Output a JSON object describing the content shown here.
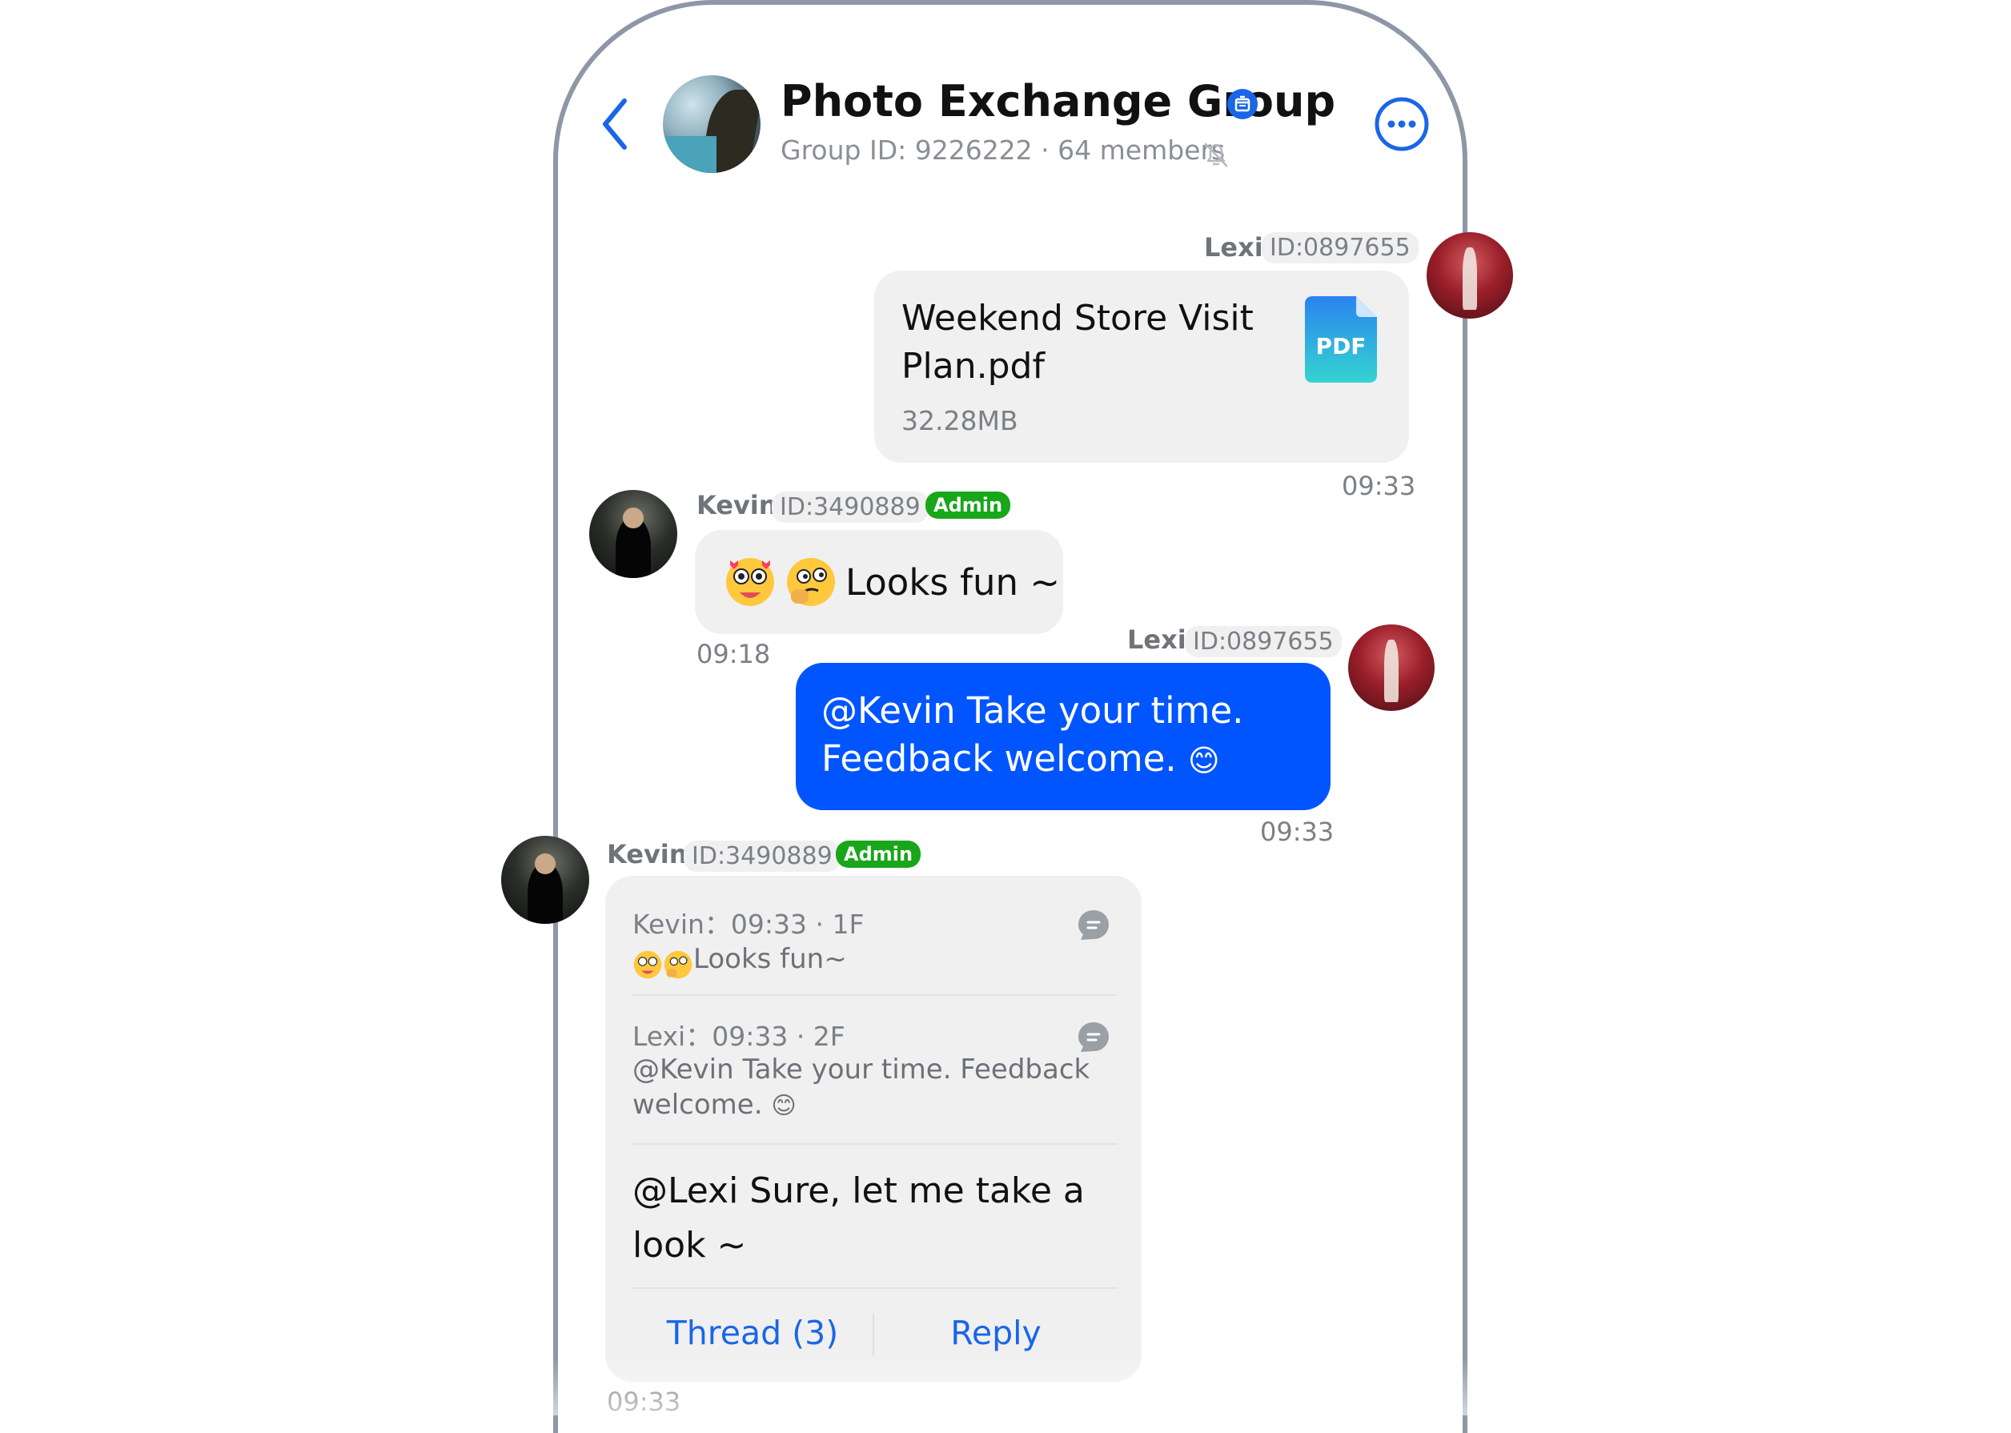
{
  "header": {
    "back_icon": "chevron-left-icon",
    "group_name": "Photo Exchange Group",
    "group_badge_icon": "verified-group-icon",
    "subtitle": "Group ID: 9226222 · 64 members",
    "muted_icon": "bell-off-icon",
    "more_icon": "more-horizontal-icon",
    "accent_color": "#0055ff"
  },
  "messages": {
    "m1": {
      "sender": "Lexi",
      "sender_id": "ID:0897655",
      "file_name_line1": "Weekend Store Visit",
      "file_name_line2": "Plan.pdf",
      "file_size": "32.28MB",
      "file_icon_label": "PDF",
      "time": "09:33"
    },
    "m2": {
      "sender": "Kevin",
      "sender_id": "ID:3490889",
      "role": "Admin",
      "text": "Looks fun ~",
      "time": "09:18"
    },
    "m3": {
      "sender": "Lexi",
      "sender_id": "ID:0897655",
      "line1": "@Kevin Take your time.",
      "line2": "Feedback welcome.",
      "emoji": "😊",
      "time": "09:33"
    },
    "m4": {
      "sender": "Kevin",
      "sender_id": "ID:3490889",
      "role": "Admin",
      "quote1_meta": "Kevin：09:33 · 1F",
      "quote1_text": "Looks fun~",
      "quote2_meta": "Lexi：09:33 · 2F",
      "quote2_line1": "@Kevin Take your time. Feedback",
      "quote2_line2": "welcome.",
      "quote2_emoji": "😊",
      "reply_line1": "@Lexi Sure, let me take a",
      "reply_line2": "look ~",
      "thread_label": "Thread (3)",
      "reply_label": "Reply",
      "time": "09:33"
    }
  }
}
